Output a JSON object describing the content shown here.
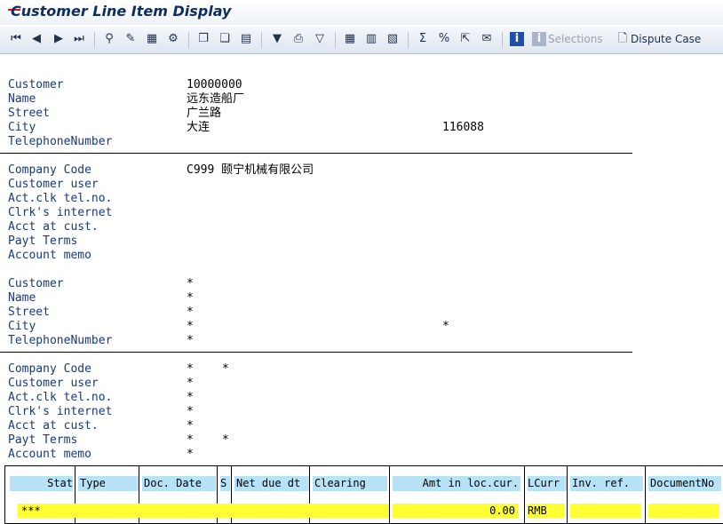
{
  "window": {
    "title": "Customer Line Item Display"
  },
  "toolbar": {
    "icons": [
      "first-page-icon",
      "previous-page-icon",
      "next-page-icon",
      "last-page-icon",
      "choose-icon",
      "edit-pencil-icon",
      "mass-change-icon",
      "settings-icon",
      "document-icon",
      "document-change-icon",
      "print-preview-icon",
      "filter-icon",
      "print-icon",
      "set-filter-icon",
      "layout-icon",
      "change-layout-icon",
      "save-layout-icon",
      "sum-icon",
      "subtotal-icon",
      "export-icon",
      "mail-icon",
      "info-icon",
      "selections-icon",
      "dispute-case-icon"
    ],
    "selections_label": "Selections",
    "dispute_case_label": "Dispute Case"
  },
  "header1": {
    "rows": [
      {
        "label": "Customer",
        "value": "10000000"
      },
      {
        "label": "Name",
        "value": "远东造船厂"
      },
      {
        "label": "Street",
        "value": "广兰路"
      },
      {
        "label": "City",
        "value": "大连",
        "extra": "116088"
      },
      {
        "label": "TelephoneNumber",
        "value": ""
      }
    ]
  },
  "company1": {
    "rows": [
      {
        "label": "Company Code",
        "value": "C999 颐宁机械有限公司"
      },
      {
        "label": "Customer user",
        "value": ""
      },
      {
        "label": "Act.clk tel.no.",
        "value": ""
      },
      {
        "label": "Clrk's internet",
        "value": ""
      },
      {
        "label": "Acct at cust.",
        "value": ""
      },
      {
        "label": "Payt Terms",
        "value": ""
      },
      {
        "label": "Account memo",
        "value": ""
      }
    ]
  },
  "header2": {
    "rows": [
      {
        "label": "Customer",
        "value": "*"
      },
      {
        "label": "Name",
        "value": "*"
      },
      {
        "label": "Street",
        "value": "*"
      },
      {
        "label": "City",
        "value": "*",
        "extra": "*"
      },
      {
        "label": "TelephoneNumber",
        "value": "*"
      }
    ]
  },
  "company2": {
    "rows": [
      {
        "label": "Company Code",
        "value": "*",
        "extra": "*"
      },
      {
        "label": "Customer user",
        "value": "*"
      },
      {
        "label": "Act.clk tel.no.",
        "value": "*"
      },
      {
        "label": "Clrk's internet",
        "value": "*"
      },
      {
        "label": "Acct at cust.",
        "value": "*"
      },
      {
        "label": "Payt Terms",
        "value": "*",
        "extra": "*"
      },
      {
        "label": "Account memo",
        "value": "*"
      }
    ]
  },
  "table": {
    "columns": [
      "Stat",
      "Type",
      "Doc. Date",
      "S",
      "Net due dt",
      "Clearing",
      "Amt in loc.cur.",
      "LCurr",
      "Inv. ref.",
      "DocumentNo"
    ],
    "total_row": {
      "marker": "***",
      "amount": "0.00",
      "currency": "RMB"
    }
  },
  "colors": {
    "header_cell": "#b8e3f7",
    "total_row": "#ffff33",
    "label": "#1b3a78",
    "title": "#0e2f5c"
  }
}
